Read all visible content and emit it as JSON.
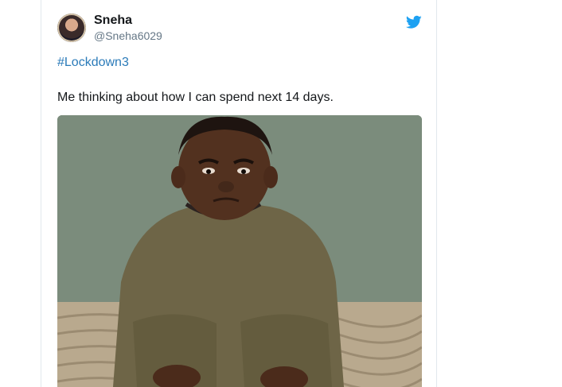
{
  "tweet": {
    "author_name": "Sneha",
    "author_handle": "@Sneha6029",
    "hashtag": "#Lockdown3",
    "text": "Me thinking about how I can spend next 14 days."
  },
  "icons": {
    "brand": "twitter-bird-icon"
  },
  "colors": {
    "link": "#2b7bb9",
    "twitter_blue": "#1da1f2",
    "handle_gray": "#657786"
  }
}
